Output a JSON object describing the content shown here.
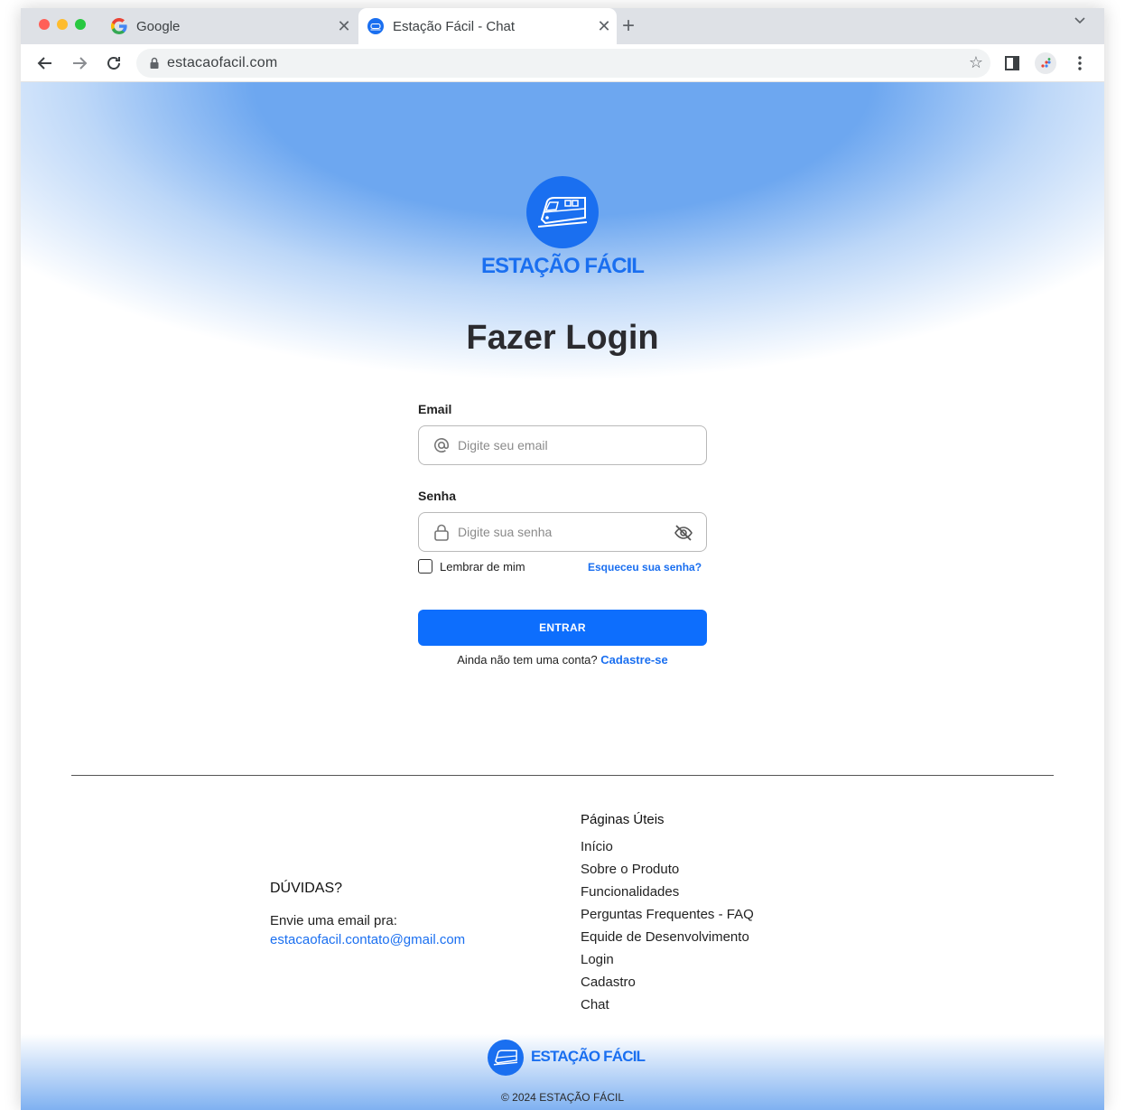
{
  "browser": {
    "tabs": [
      {
        "title": "Google",
        "favicon": "google-icon"
      },
      {
        "title": "Estação Fácil - Chat",
        "favicon": "estacao-facil-icon",
        "active": true
      }
    ],
    "url": "estacaofacil.com"
  },
  "login": {
    "brand": "ESTAÇÃO FÁCIL",
    "title": "Fazer Login",
    "email_label": "Email",
    "email_placeholder": "Digite seu email",
    "password_label": "Senha",
    "password_placeholder": "Digite sua senha",
    "remember_label": "Lembrar de mim",
    "forgot_label": "Esqueceu sua senha?",
    "submit_label": "ENTRAR",
    "signup_prompt": "Ainda não tem uma conta?",
    "signup_link": "Cadastre-se"
  },
  "footer": {
    "doubts_title": "DÚVIDAS?",
    "doubts_text": "Envie uma email pra:",
    "email": "estacaofacil.contato@gmail.com",
    "pages_title": "Páginas Úteis",
    "pages": [
      "Início",
      "Sobre o Produto",
      "Funcionalidades",
      "Perguntas Frequentes - FAQ",
      "Equide de Desenvolvimento",
      "Login",
      "Cadastro",
      "Chat"
    ],
    "brand": "ESTAÇÃO FÁCIL",
    "copyright": "© 2024 ESTAÇÃO FÁCIL"
  },
  "colors": {
    "accent": "#0d6efd",
    "brand": "#1a6ff0"
  }
}
